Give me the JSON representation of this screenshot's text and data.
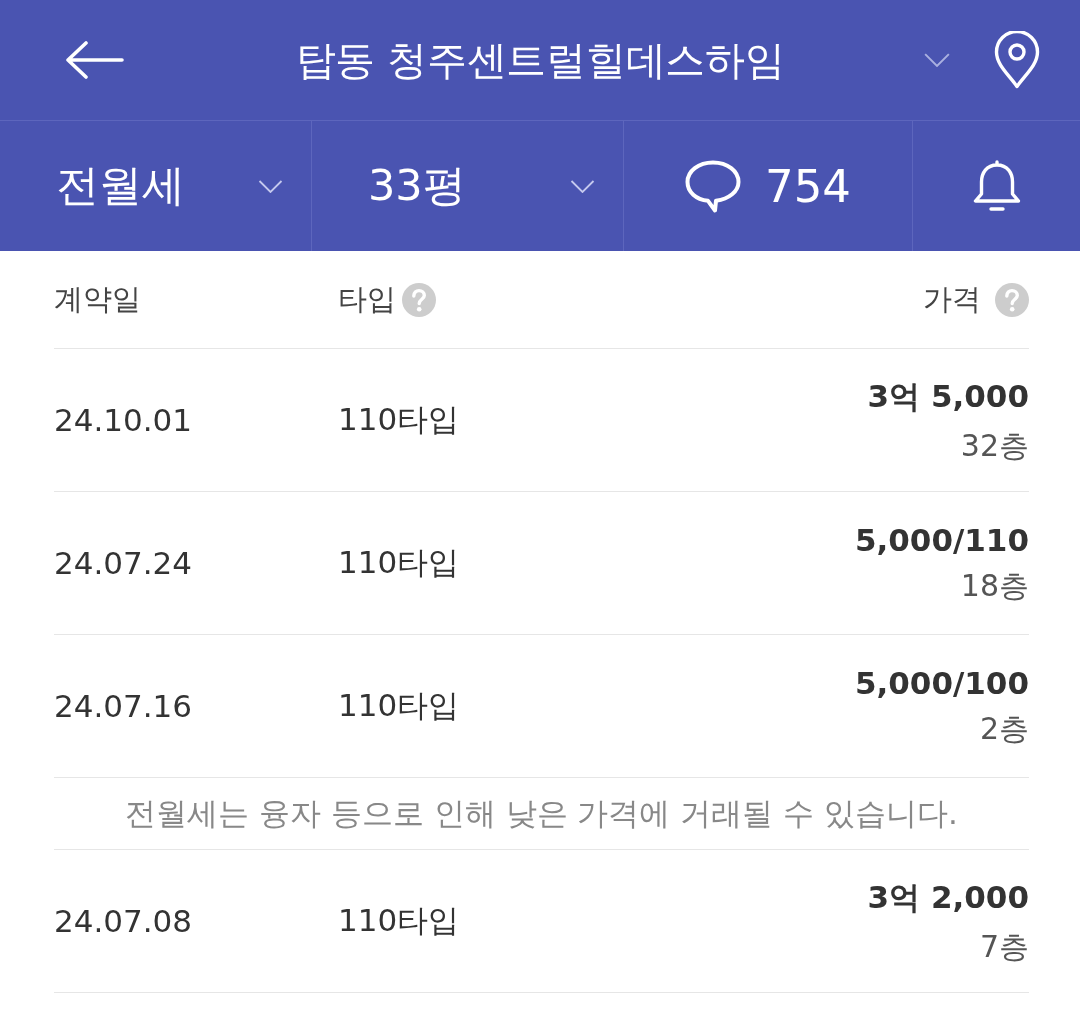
{
  "header": {
    "title": "탑동 청주센트럴힐데스하임"
  },
  "filters": [
    {
      "kind": "dropdown",
      "label": "전월세"
    },
    {
      "kind": "dropdown",
      "label": "33평"
    },
    {
      "kind": "comments",
      "label": "754"
    },
    {
      "kind": "alert"
    }
  ],
  "table": {
    "columns": [
      {
        "label": "계약일",
        "help": false
      },
      {
        "label": "타입",
        "help": true
      },
      {
        "label": "가격",
        "help": true
      }
    ],
    "rows": [
      {
        "kind": "deal",
        "date": "24.10.01",
        "type": "110타입",
        "price": "3억 5,000",
        "floor": "32층"
      },
      {
        "kind": "deal",
        "date": "24.07.24",
        "type": "110타입",
        "price": "5,000/110",
        "floor": "18층"
      },
      {
        "kind": "deal",
        "date": "24.07.16",
        "type": "110타입",
        "price": "5,000/100",
        "floor": "2층"
      },
      {
        "kind": "notice",
        "text": "전월세는 융자 등으로 인해 낮은 가격에 거래될 수 있습니다."
      },
      {
        "kind": "deal",
        "date": "24.07.08",
        "type": "110타입",
        "price": "3억 2,000",
        "floor": "7층"
      }
    ]
  }
}
